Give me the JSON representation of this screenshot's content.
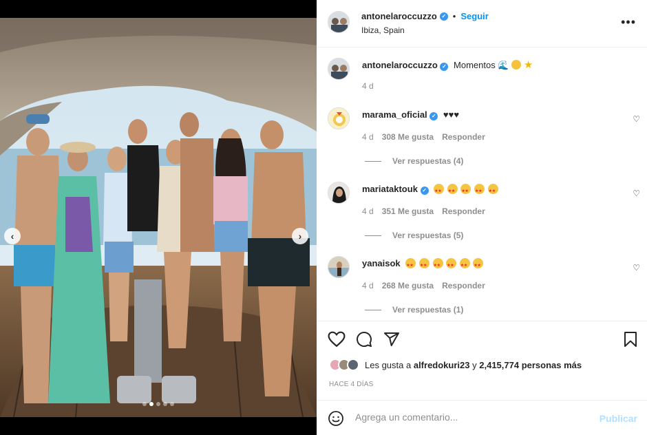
{
  "header": {
    "username": "antonelaroccuzzo",
    "follow_label": "Seguir",
    "location": "Ibiza, Spain",
    "more_icon": "more-icon"
  },
  "caption": {
    "username": "antonelaroccuzzo",
    "text": "Momentos",
    "time": "4 d"
  },
  "comments": [
    {
      "username": "marama_oficial",
      "text": "♥♥♥",
      "time": "4 d",
      "likes": "308 Me gusta",
      "reply_label": "Responder",
      "view_replies": "Ver respuestas (4)"
    },
    {
      "username": "mariataktouk",
      "text": "",
      "time": "4 d",
      "likes": "351 Me gusta",
      "reply_label": "Responder",
      "view_replies": "Ver respuestas (5)"
    },
    {
      "username": "yanaisok",
      "text": "",
      "time": "4 d",
      "likes": "268 Me gusta",
      "reply_label": "Responder",
      "view_replies": "Ver respuestas (1)"
    }
  ],
  "likes": {
    "prefix": "Les gusta a",
    "user": "alfredokuri23",
    "connector": "y",
    "count": "2,415,774 personas más"
  },
  "time_ago": "HACE 4 DÍAS",
  "add_comment": {
    "placeholder": "Agrega un comentario...",
    "publish_label": "Publicar"
  },
  "carousel": {
    "slide_count": 5,
    "active_index": 1
  },
  "colors": {
    "accent": "#0095f6",
    "verified": "#3897f0",
    "publish_disabled": "#b2dffc",
    "muted": "#8e8e8e"
  }
}
